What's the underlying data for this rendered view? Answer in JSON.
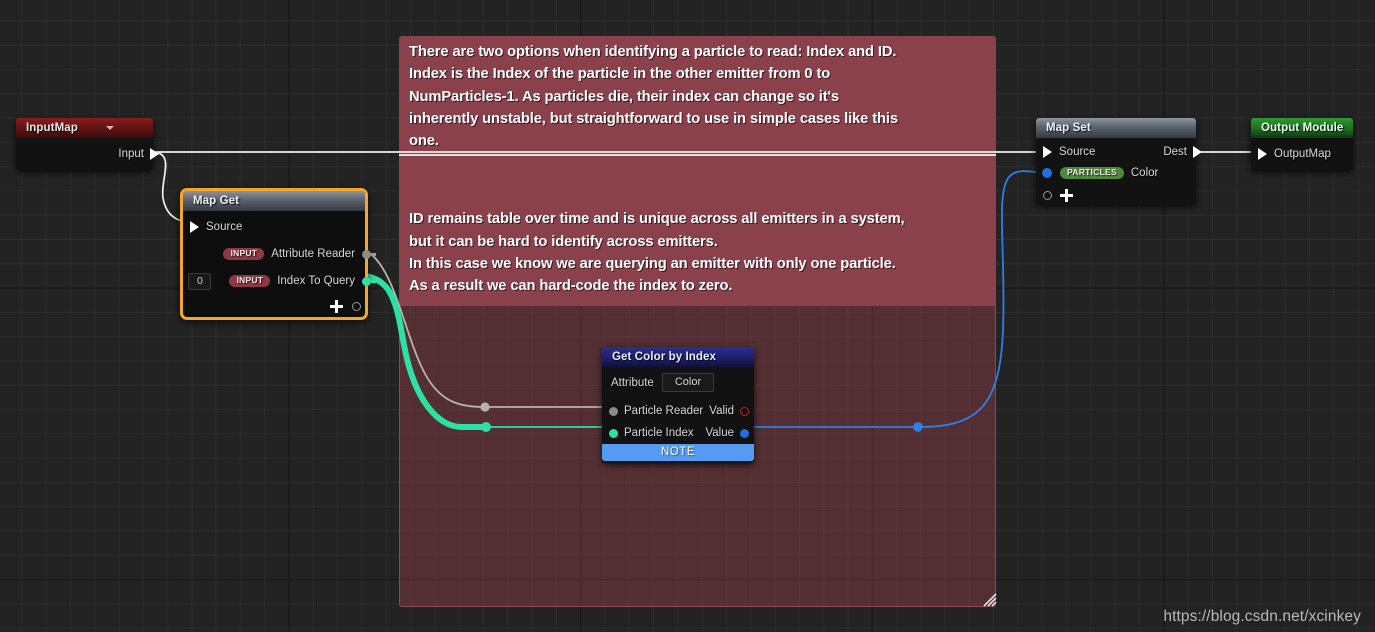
{
  "canvas": {
    "watermark": "https://blog.csdn.net/xcinkey"
  },
  "comment": {
    "paragraph1": "There are two options when identifying a particle to read: Index and ID.\nIndex is the Index of the particle in the other emitter from 0 to\nNumParticles-1. As particles die, their index can change so it's\ninherently unstable, but straightforward to use in simple cases like this\none.",
    "paragraph2": "ID remains table over time and is unique across all emitters in a system,\nbut it can be hard to identify across emitters.\nIn this case we know we are querying an emitter with only one particle.\nAs a result we can hard-code the index to zero.",
    "fill_color": "#8a414c",
    "resize_handle_icon": "resize-grip-icon"
  },
  "nodes": {
    "input_map": {
      "title": "InputMap",
      "caret_icon": "chevron-down-icon",
      "output_pin": {
        "label": "Input",
        "icon": "exec-triangle-pin-icon"
      }
    },
    "map_get": {
      "title": "Map Get",
      "source_pin": {
        "label": "Source",
        "icon": "exec-triangle-pin-icon"
      },
      "rows": [
        {
          "badge": "INPUT",
          "label": "Attribute Reader",
          "value": "",
          "pin_color": "#8c8c8c"
        },
        {
          "badge": "INPUT",
          "label": "Index To Query",
          "value": "0",
          "pin_color": "#2de0a4"
        }
      ],
      "add_pin": {
        "plus_icon": "plus-icon",
        "pin_icon": "hollow-circle-pin-icon"
      },
      "selected_border_color": "#f2a62a"
    },
    "get_color_by_index": {
      "title": "Get Color by Index",
      "attribute_label": "Attribute",
      "attribute_value": "Color",
      "inputs": [
        {
          "label": "Particle Reader",
          "pin_color": "#8c8c8c"
        },
        {
          "label": "Particle Index",
          "pin_color": "#2de0a4"
        }
      ],
      "outputs": [
        {
          "label": "Valid",
          "pin_color": "#c31f1f",
          "style": "hollow"
        },
        {
          "label": "Value",
          "pin_color": "#1f6fe0",
          "style": "solid"
        }
      ],
      "footer": "NOTE",
      "footer_color": "#559bf2"
    },
    "map_set": {
      "title": "Map Set",
      "source_pin": {
        "label": "Source",
        "icon": "exec-triangle-pin-icon"
      },
      "dest_pin": {
        "label": "Dest",
        "icon": "exec-triangle-pin-icon"
      },
      "rows": [
        {
          "badge": "PARTICLES",
          "label": "Color",
          "pin_color": "#1f6fe0"
        }
      ],
      "add_pin": {
        "plus_icon": "plus-icon",
        "pin_icon": "hollow-circle-pin-icon"
      }
    },
    "output_module": {
      "title": "Output Module",
      "input_pin": {
        "label": "OutputMap",
        "icon": "exec-triangle-pin-icon"
      }
    }
  },
  "wires": {
    "input_to_mapset": "#f0f0f0",
    "input_to_mapget": "#f0f0f0",
    "attribute_reader_to_particle_reader": "#b9b2ad",
    "index_to_particle_index": "#2de0a4",
    "value_to_color": "#2f7fe8",
    "dest_to_outputmap": "#f0f0f0"
  }
}
